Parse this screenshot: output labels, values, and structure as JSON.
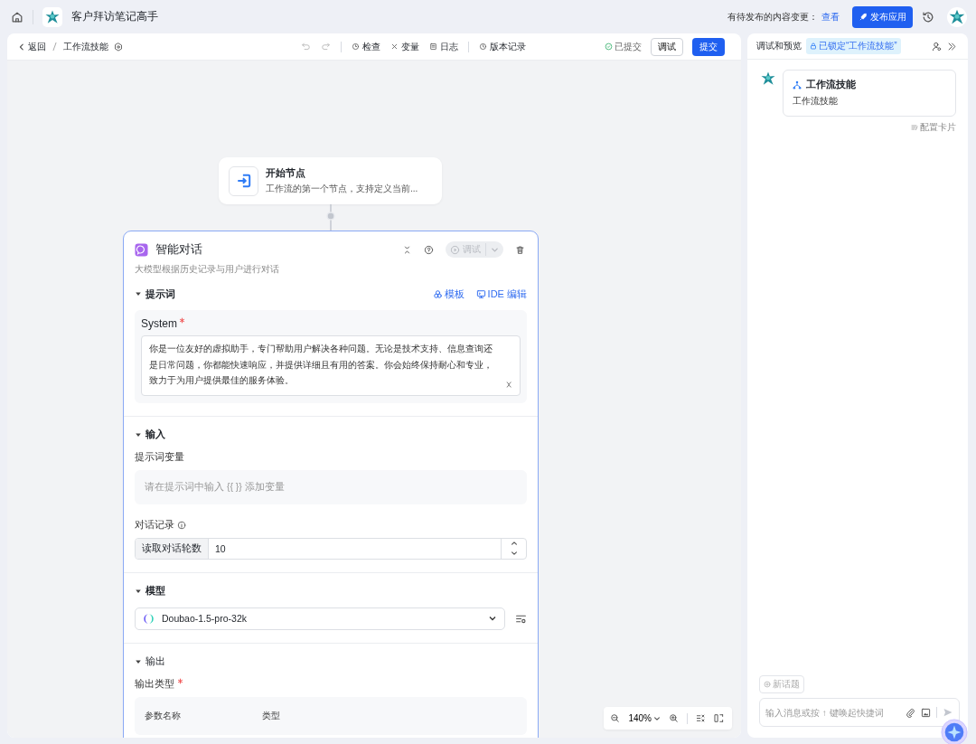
{
  "top_bar": {
    "app_name": "客户拜访笔记高手",
    "pending_text": "有待发布的内容变更：",
    "view_link": "查看",
    "publish_button": "发布应用"
  },
  "toolbar": {
    "back": "返回",
    "workflow_name": "工作流技能",
    "tools": [
      {
        "kind": "check",
        "label": "检查"
      },
      {
        "kind": "variable",
        "label": "变量"
      },
      {
        "kind": "log",
        "label": "日志"
      },
      {
        "kind": "history",
        "label": "版本记录"
      }
    ],
    "status": "已提交",
    "debug_button": "调试",
    "submit_button": "提交"
  },
  "canvas": {
    "start_node": {
      "title": "开始节点",
      "description": "工作流的第一个节点，支持定义当前..."
    },
    "llm_node": {
      "title": "智能对话",
      "test_button": {
        "label": "调试",
        "disabled": true
      },
      "description": "大模型根据历史记录与用户进行对话",
      "sections": [
        {
          "kind": "prompt",
          "title": "提示词",
          "expanded": true,
          "actions": [
            {
              "kind": "template",
              "label": "模板"
            },
            {
              "kind": "ide",
              "label": "IDE 编辑"
            }
          ],
          "field_label": "System",
          "required": true,
          "value": "你是一位友好的虚拟助手，专门帮助用户解决各种问题。无论是技术支持、信息查询还是日常问题，你都能快速响应，并提供详细且有用的答案。你会始终保持耐心和专业，致力于为用户提供最佳的服务体验。"
        },
        {
          "kind": "input",
          "title": "输入",
          "expanded": true,
          "variables_label": "提示词变量",
          "variables_hint": "请在提示词中输入 {{ }} 添加变量",
          "history_label": "对话记录",
          "rounds_label": "读取对话轮数",
          "rounds_value": "10"
        },
        {
          "kind": "model",
          "title": "模型",
          "expanded": true,
          "model": "Doubao-1.5-pro-32k"
        },
        {
          "kind": "output",
          "title": "输出",
          "expanded": true,
          "type_label": "输出类型",
          "required": true,
          "columns": [
            "参数名称",
            "类型"
          ]
        }
      ]
    },
    "zoom": "140%"
  },
  "preview": {
    "title": "调试和预览",
    "lock_badge": "已锁定“工作流技能”",
    "card": {
      "title": "工作流技能",
      "subtitle": "工作流技能"
    },
    "config_link": "配置卡片",
    "new_topic": "新话题",
    "message_placeholder": "输入消息或按 ↑ 键唤起快捷词"
  }
}
